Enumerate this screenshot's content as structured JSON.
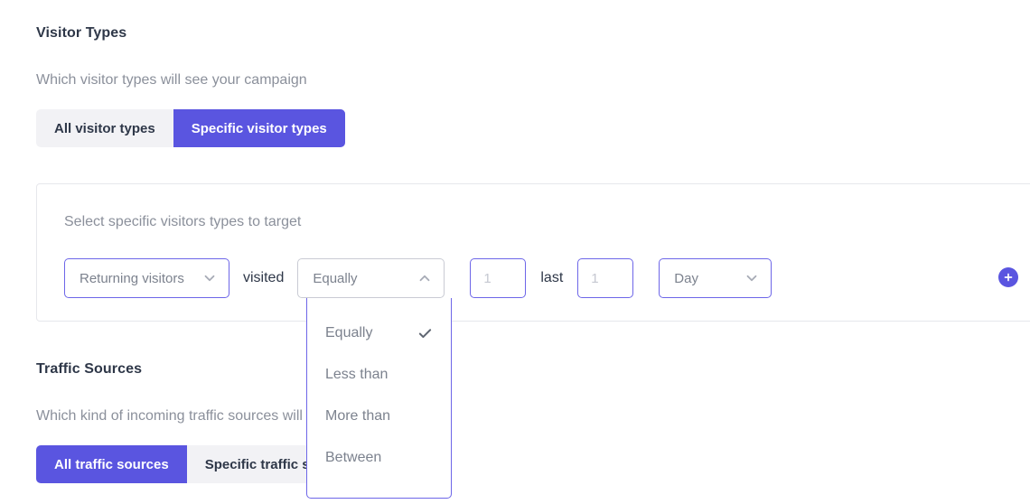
{
  "visitor_section": {
    "title": "Visitor Types",
    "description": "Which visitor types will see your campaign",
    "tabs": [
      {
        "label": "All visitor types",
        "active": false
      },
      {
        "label": "Specific visitor types",
        "active": true
      }
    ],
    "builder": {
      "label": "Select specific visitors types to target",
      "visitor_select": {
        "value": "Returning visitors",
        "icon": "chevron-down-icon",
        "state": "closed"
      },
      "word_visited": "visited",
      "operator_select": {
        "value": "Equally",
        "icon": "chevron-up-icon",
        "state": "open"
      },
      "count_input": {
        "value": "",
        "placeholder": "1"
      },
      "word_last": "last",
      "duration_input": {
        "value": "",
        "placeholder": "1"
      },
      "unit_select": {
        "value": "Day",
        "icon": "chevron-down-icon",
        "state": "closed"
      },
      "add_button": {
        "icon": "plus-icon",
        "label": "+"
      }
    }
  },
  "operator_dropdown": {
    "open": true,
    "selected": "Equally",
    "options": [
      {
        "label": "Equally",
        "checked": true
      },
      {
        "label": "Less than",
        "checked": false
      },
      {
        "label": "More than",
        "checked": false
      },
      {
        "label": "Between",
        "checked": false
      }
    ]
  },
  "traffic_section": {
    "title": "Traffic Sources",
    "description": "Which kind of incoming traffic sources will see your campaign",
    "tabs": [
      {
        "label": "All traffic sources",
        "active": true
      },
      {
        "label": "Specific traffic sources",
        "active": false
      }
    ]
  },
  "colors": {
    "accent": "#5a55e0",
    "accent_border": "#6d66e8",
    "tab_inactive_bg": "#f2f2f5",
    "heading": "#2e3748",
    "muted": "#8b909b",
    "panel_border": "#e6e7ec"
  }
}
